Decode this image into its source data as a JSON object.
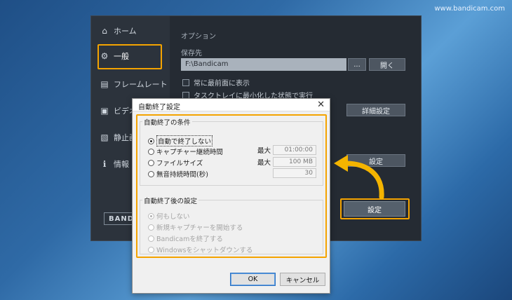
{
  "watermark": "www.bandicam.com",
  "main_window": {
    "sidebar": {
      "items": [
        {
          "label": "ホーム",
          "icon": "home-icon",
          "glyph": "⌂"
        },
        {
          "label": "一般",
          "icon": "gear-icon",
          "glyph": "⚙"
        },
        {
          "label": "フレームレート",
          "icon": "film-icon",
          "glyph": "▤"
        },
        {
          "label": "ビデオ",
          "icon": "video-icon",
          "glyph": "▣"
        },
        {
          "label": "静止画",
          "icon": "image-icon",
          "glyph": "▧"
        },
        {
          "label": "情報",
          "icon": "info-icon",
          "glyph": "ℹ"
        }
      ],
      "logo_text": "BANDI"
    },
    "content": {
      "options_label": "オプション",
      "save_to_label": "保存先",
      "save_path": "F:\\Bandicam",
      "browse_label": "...",
      "open_label": "開く",
      "always_on_top_label": "常に最前面に表示",
      "minimize_to_tray_label": "タスクトレイに最小化した状態で実行",
      "advanced_label": "詳細設定",
      "settings_label_upper": "設定",
      "settings_label": "設定"
    }
  },
  "dialog": {
    "title": "自動終了設定",
    "close_glyph": "✕",
    "condition_group": {
      "title": "自動終了の条件",
      "options": [
        {
          "label": "自動で終了しない",
          "selected": true
        },
        {
          "label": "キャプチャー継続時間",
          "selected": false
        },
        {
          "label": "ファイルサイズ",
          "selected": false
        },
        {
          "label": "無音持続時間(秒)",
          "selected": false
        }
      ],
      "max_label_1": "最大",
      "max_label_2": "最大",
      "duration_value": "01:00:00",
      "filesize_value": "100 MB",
      "silence_value": "30"
    },
    "after_group": {
      "title": "自動終了後の設定",
      "options": [
        {
          "label": "何もしない",
          "selected": true
        },
        {
          "label": "新規キャプチャーを開始する",
          "selected": false
        },
        {
          "label": "Bandicamを終了する",
          "selected": false
        },
        {
          "label": "Windowsをシャットダウンする",
          "selected": false
        }
      ]
    },
    "ok_label": "OK",
    "cancel_label": "キャンセル"
  },
  "colors": {
    "highlight": "#f4a300",
    "arrow": "#f4b400",
    "dialog_bg": "#f0f0f0"
  }
}
